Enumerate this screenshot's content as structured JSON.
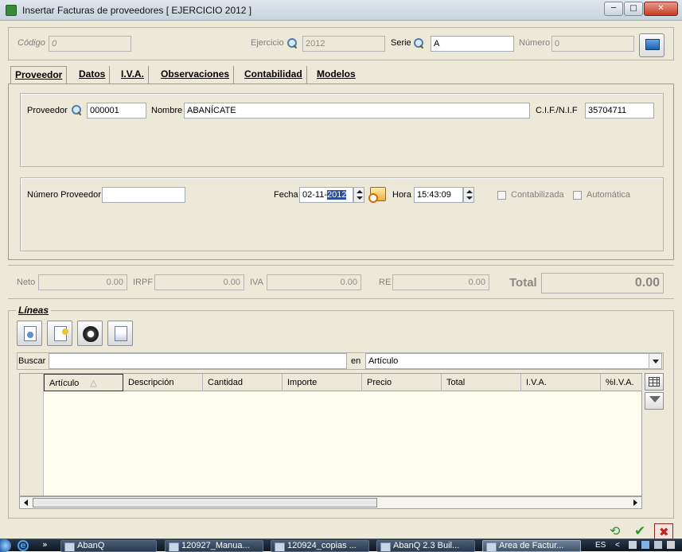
{
  "window": {
    "title": "Insertar Facturas de proveedores [ EJERCICIO 2012 ]",
    "min_label": "─",
    "max_label": "□",
    "close_label": "✕"
  },
  "header": {
    "codigo_label": "Código",
    "codigo_value": "0",
    "ejercicio_label": "Ejercicio",
    "ejercicio_value": "2012",
    "serie_label": "Serie",
    "serie_value": "A",
    "numero_label": "Número",
    "numero_value": "0"
  },
  "tabs": [
    {
      "label": "Proveedor",
      "active": true
    },
    {
      "label": "Datos"
    },
    {
      "label": "I.V.A."
    },
    {
      "label": "Observaciones"
    },
    {
      "label": "Contabilidad"
    },
    {
      "label": "Modelos"
    }
  ],
  "proveedor": {
    "proveedor_label": "Proveedor",
    "proveedor_value": "000001",
    "nombre_label": "Nombre",
    "nombre_value": "ABANÍCATE",
    "cif_label": "C.I.F./N.I.F",
    "cif_value": "35704711",
    "numero_proveedor_label": "Número Proveedor",
    "numero_proveedor_value": "",
    "fecha_label": "Fecha",
    "fecha_prefix": "02-11-",
    "fecha_selected": "2012",
    "hora_label": "Hora",
    "hora_value": "15:43:09",
    "contabilizada_label": "Contabilizada",
    "automatica_label": "Automática"
  },
  "totals": {
    "neto_label": "Neto",
    "neto_value": "0.00",
    "irpf_label": "IRPF",
    "irpf_value": "0.00",
    "iva_label": "IVA",
    "iva_value": "0.00",
    "re_label": "RE",
    "re_value": "0.00",
    "total_label": "Total",
    "total_value": "0.00"
  },
  "lineas": {
    "title": "Líneas",
    "buscar_label": "Buscar",
    "buscar_value": "",
    "en_label": "en",
    "en_value": "Artículo",
    "columns": [
      "Artículo",
      "Descripción",
      "Cantidad",
      "Importe",
      "Precio",
      "Total",
      "I.V.A.",
      "%I.V.A."
    ],
    "sort_indicator": "△"
  },
  "taskbar": {
    "items": [
      {
        "label": "AbanQ"
      },
      {
        "label": "120927_Manua..."
      },
      {
        "label": "120924_copias ..."
      },
      {
        "label": "AbanQ 2.3 Buil..."
      },
      {
        "label": "Area de Factur...",
        "active": true
      }
    ],
    "language": "ES",
    "quicklaunch_more": "»",
    "tray_chevron": "<"
  }
}
